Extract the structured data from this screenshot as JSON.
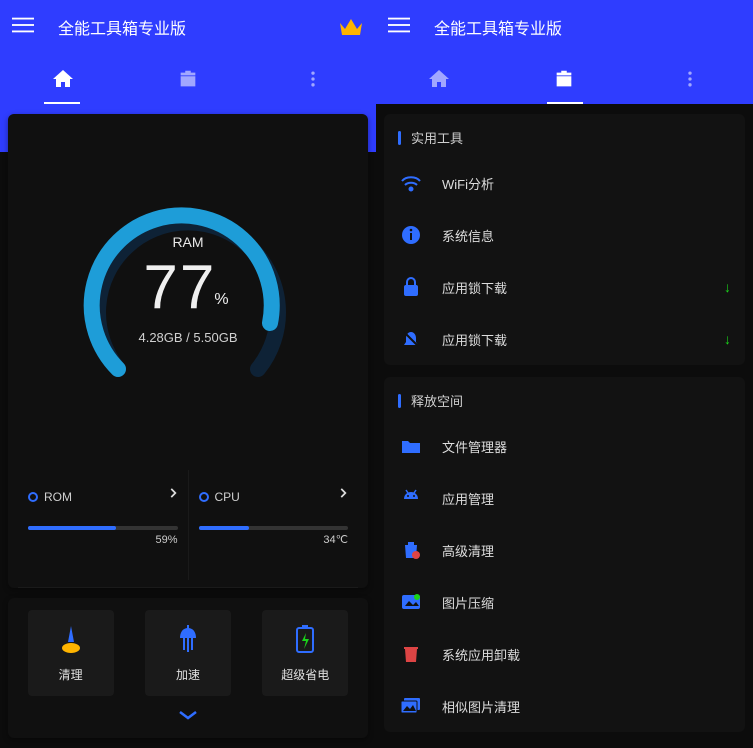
{
  "left": {
    "title": "全能工具箱专业版",
    "ram_label": "RAM",
    "ram_percent": "77",
    "ram_percent_unit": "%",
    "ram_sub": "4.28GB / 5.50GB",
    "rom_label": "ROM",
    "rom_percent": 59,
    "rom_value": "59%",
    "cpu_label": "CPU",
    "cpu_percent": 34,
    "cpu_value": "34℃",
    "actions": [
      {
        "label": "清理"
      },
      {
        "label": "加速"
      },
      {
        "label": "超级省电"
      }
    ]
  },
  "right": {
    "title": "全能工具箱专业版",
    "sections": [
      {
        "title": "实用工具",
        "items": [
          {
            "label": "WiFi分析",
            "icon": "wifi"
          },
          {
            "label": "系统信息",
            "icon": "info"
          },
          {
            "label": "应用锁下载",
            "icon": "lock",
            "download": true
          },
          {
            "label": "应用锁下载",
            "icon": "bell",
            "download": true
          }
        ]
      },
      {
        "title": "释放空间",
        "items": [
          {
            "label": "文件管理器",
            "icon": "folder"
          },
          {
            "label": "应用管理",
            "icon": "android"
          },
          {
            "label": "高级清理",
            "icon": "trash"
          },
          {
            "label": "图片压缩",
            "icon": "image-star"
          },
          {
            "label": "系统应用卸载",
            "icon": "trash2"
          },
          {
            "label": "相似图片清理",
            "icon": "images"
          }
        ]
      }
    ]
  },
  "chart_data": {
    "type": "bar",
    "title": "RAM gauge + ROM/CPU meters",
    "series": [
      {
        "name": "RAM",
        "values": [
          77
        ],
        "unit": "%",
        "caption": "4.28GB / 5.50GB"
      },
      {
        "name": "ROM",
        "values": [
          59
        ],
        "unit": "%"
      },
      {
        "name": "CPU",
        "values": [
          34
        ],
        "unit": "℃"
      }
    ],
    "ylim": [
      0,
      100
    ]
  }
}
